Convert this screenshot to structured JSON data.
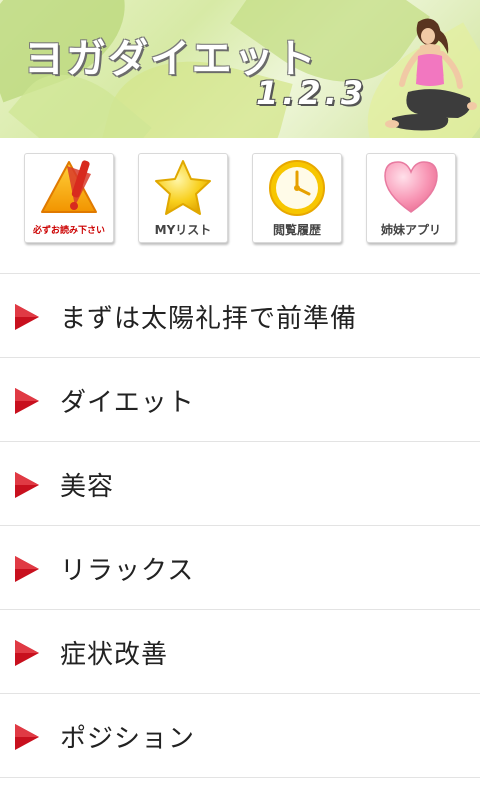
{
  "header": {
    "title": "ヨガダイエット",
    "version": "1.2.3"
  },
  "icons": [
    {
      "label": "必ずお読み下さい",
      "icon": "warning-icon"
    },
    {
      "label": "MYリスト",
      "icon": "star-icon"
    },
    {
      "label": "閲覧履歴",
      "icon": "clock-icon"
    },
    {
      "label": "姉妹アプリ",
      "icon": "heart-icon"
    }
  ],
  "menu": [
    {
      "label": "まずは太陽礼拝で前準備"
    },
    {
      "label": "ダイエット"
    },
    {
      "label": "美容"
    },
    {
      "label": "リラックス"
    },
    {
      "label": "症状改善"
    },
    {
      "label": "ポジション"
    }
  ],
  "colors": {
    "arrow": "#c8101e",
    "warning": "#f5a400",
    "star": "#f6c400",
    "clock": "#f3c400",
    "heart": "#f48aa8"
  }
}
